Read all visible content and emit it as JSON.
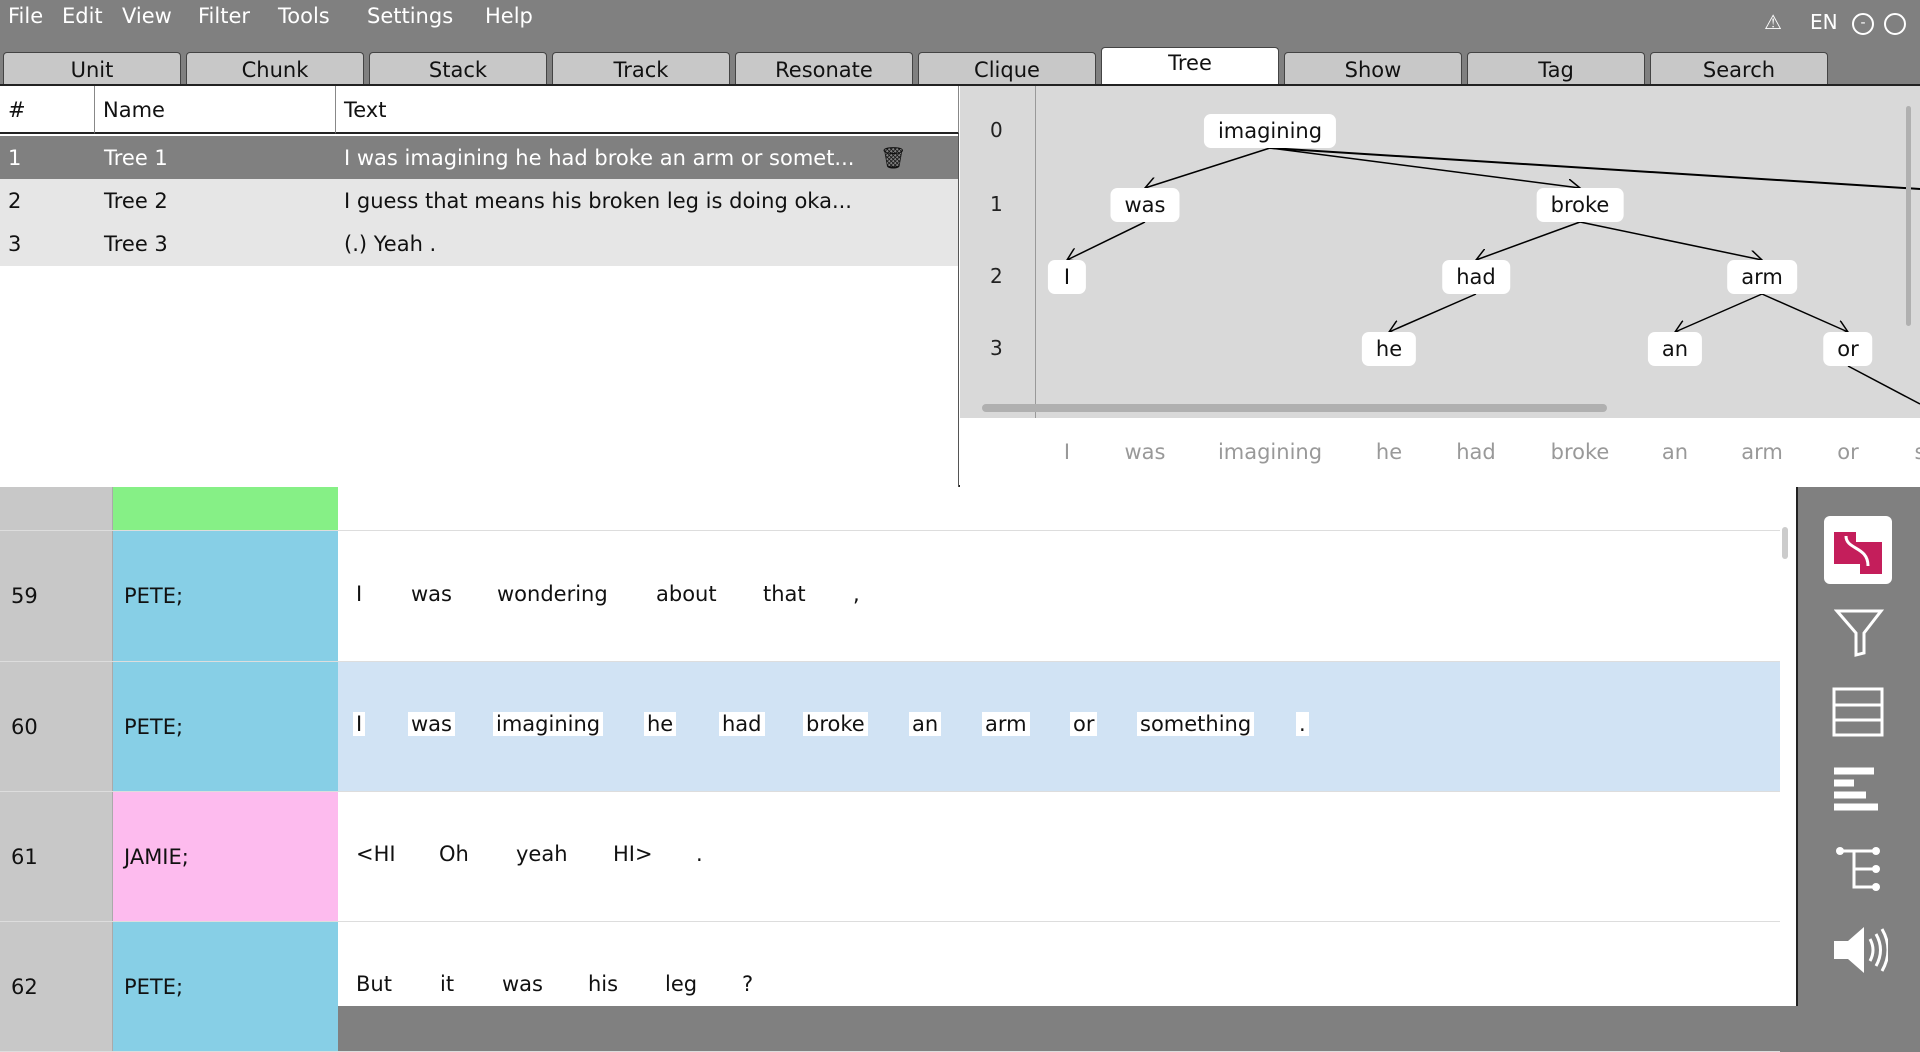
{
  "menu": [
    "File",
    "Edit",
    "View",
    "Filter",
    "Tools",
    "Settings",
    "Help"
  ],
  "status": {
    "language": "EN",
    "warning_icon": "warning-icon"
  },
  "tabs": [
    "Unit",
    "Chunk",
    "Stack",
    "Track",
    "Resonate",
    "Clique",
    "Tree",
    "Show",
    "Tag",
    "Search"
  ],
  "active_tab": "Tree",
  "tree_list": {
    "headers": [
      "#",
      "Name",
      "Text"
    ],
    "rows": [
      {
        "num": "1",
        "name": "Tree 1",
        "text": "I was imagining he had broke an arm or somet..."
      },
      {
        "num": "2",
        "name": "Tree 2",
        "text": "I guess that means his broken leg is doing oka..."
      },
      {
        "num": "3",
        "name": "Tree 3",
        "text": "(.) Yeah ."
      }
    ]
  },
  "tree": {
    "levels": [
      "0",
      "1",
      "2",
      "3"
    ],
    "nodes": [
      {
        "w": "imagining",
        "lvl": 0
      },
      {
        "w": "was",
        "lvl": 1
      },
      {
        "w": "broke",
        "lvl": 1
      },
      {
        "w": "I",
        "lvl": 2
      },
      {
        "w": "had",
        "lvl": 2
      },
      {
        "w": "arm",
        "lvl": 2
      },
      {
        "w": "he",
        "lvl": 3
      },
      {
        "w": "an",
        "lvl": 3
      },
      {
        "w": "or",
        "lvl": 3
      }
    ],
    "words": [
      "I",
      "was",
      "imagining",
      "he",
      "had",
      "broke",
      "an",
      "arm",
      "or",
      "s"
    ]
  },
  "units": [
    {
      "num": "",
      "speaker": "",
      "color": "#86f086",
      "words": []
    },
    {
      "num": "59",
      "speaker": "PETE;",
      "color": "#87cfe6",
      "words": [
        "I",
        "was",
        "wondering",
        "about",
        "that",
        ","
      ]
    },
    {
      "num": "60",
      "speaker": "PETE;",
      "color": "#87cfe6",
      "selected": true,
      "words": [
        "I",
        "was",
        "imagining",
        "he",
        "had",
        "broke",
        "an",
        "arm",
        "or",
        "something",
        "."
      ]
    },
    {
      "num": "61",
      "speaker": "JAMIE;",
      "color": "#fdbbee",
      "words": [
        "<HI",
        "Oh",
        "yeah",
        "HI>",
        "."
      ]
    },
    {
      "num": "62",
      "speaker": "PETE;",
      "color": "#87cfe6",
      "words": [
        "But",
        "it",
        "was",
        "his",
        "leg",
        "?"
      ]
    }
  ],
  "colors": {
    "selected_row": "#d1e3f4",
    "logo": "#c41e5b",
    "list_selected": "#808080",
    "list_row": "#e6e6e6"
  },
  "sidebar_icons": [
    "app-logo-icon",
    "filter-icon",
    "table-icon",
    "left-align-icon",
    "tree-icon",
    "speaker-icon"
  ]
}
